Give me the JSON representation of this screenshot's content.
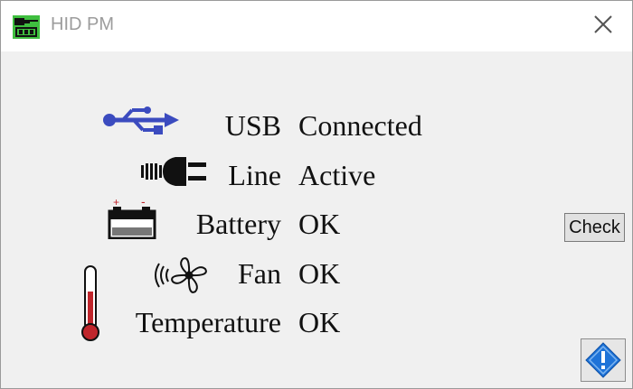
{
  "window": {
    "title": "HID PM"
  },
  "status": {
    "rows": [
      {
        "label": "USB",
        "value": "Connected",
        "icon": "usb-icon"
      },
      {
        "label": "Line",
        "value": "Active",
        "icon": "power-plug-icon"
      },
      {
        "label": "Battery",
        "value": "OK",
        "icon": "battery-icon"
      },
      {
        "label": "Fan",
        "value": "OK",
        "icon": "fan-icon"
      },
      {
        "label": "Temperature",
        "value": "OK",
        "icon": "thermometer-icon"
      }
    ]
  },
  "actions": {
    "check_label": "Check"
  },
  "colors": {
    "usb_blue": "#3b4bbf",
    "thermometer_red": "#c0262c",
    "info_blue": "#1e73d8",
    "app_icon_green": "#3fbf3f"
  }
}
